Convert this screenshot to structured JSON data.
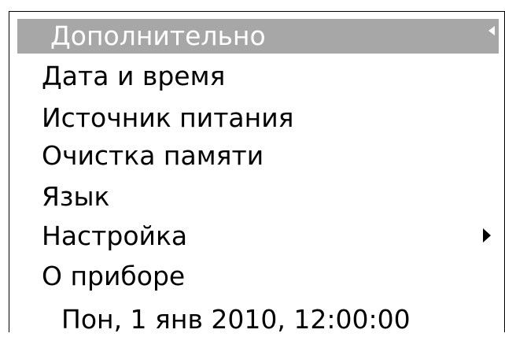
{
  "header": {
    "title": "Дополнительно",
    "back_icon": "triangle-left-icon"
  },
  "menu": {
    "items": [
      {
        "label": "Дата и время"
      },
      {
        "label": "Источник питания"
      },
      {
        "label": "Очистка памяти"
      },
      {
        "label": "Язык"
      },
      {
        "label": "Настройка",
        "submenu_icon": "triangle-right-icon"
      },
      {
        "label": "О приборе"
      }
    ]
  },
  "status": {
    "datetime": "Пон, 1 янв 2010, 12:00:00"
  },
  "colors": {
    "header_bg": "#a7a7a7",
    "header_text": "#ffffff",
    "text": "#000000",
    "background": "#ffffff"
  }
}
